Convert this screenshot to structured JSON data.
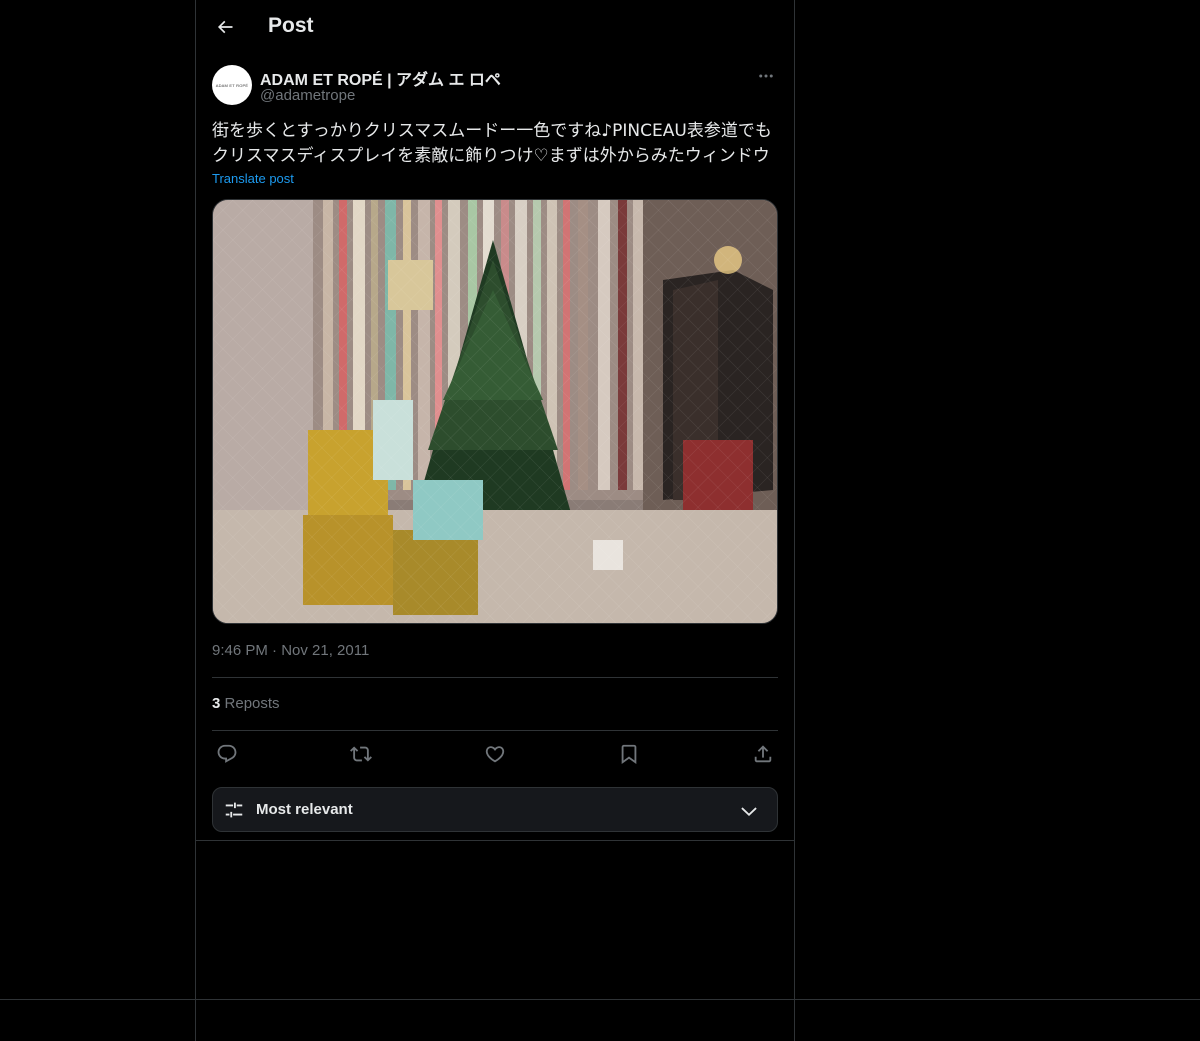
{
  "header": {
    "title": "Post"
  },
  "author": {
    "display_name": "ADAM ET ROPÉ | アダム エ ロペ",
    "handle": "@adametrope",
    "avatar_text": "ADAM ET ROPÉ"
  },
  "tweet": {
    "text_line_1": "街を歩くとすっかりクリスマスムードー一色ですね♪PINCEAU表参道でも",
    "text_line_2": "クリスマスディスプレイを素敵に飾りつけ♡まずは外からみたウィンドウ",
    "translate_label": "Translate post",
    "timestamp": "9:46 PM · Nov 21, 2011",
    "media_description_icon": "photo"
  },
  "stats": {
    "reposts_count": "3",
    "reposts_label": "Reposts"
  },
  "actions": {
    "reply_icon": "reply-icon",
    "repost_icon": "repost-icon",
    "like_icon": "heart-icon",
    "bookmark_icon": "bookmark-icon",
    "share_icon": "share-icon"
  },
  "sort": {
    "label": "Most relevant"
  },
  "colors": {
    "background": "#000000",
    "border": "#2f3336",
    "link": "#1d9bf0",
    "muted": "#71767b",
    "text": "#e7e9ea"
  }
}
